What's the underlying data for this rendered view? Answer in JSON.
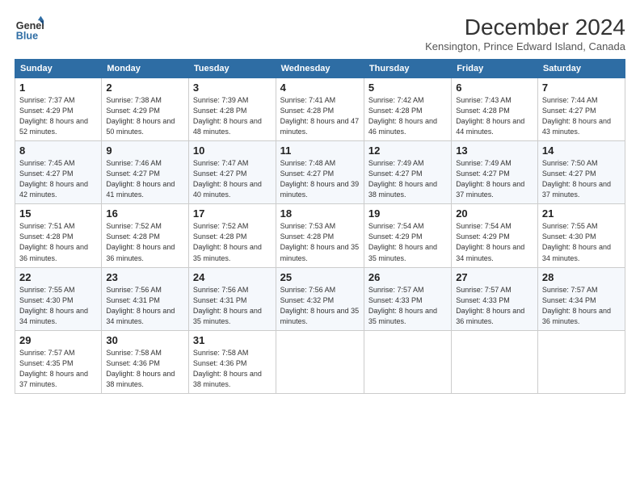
{
  "logo": {
    "line1": "General",
    "line2": "Blue"
  },
  "title": "December 2024",
  "subtitle": "Kensington, Prince Edward Island, Canada",
  "weekdays": [
    "Sunday",
    "Monday",
    "Tuesday",
    "Wednesday",
    "Thursday",
    "Friday",
    "Saturday"
  ],
  "weeks": [
    [
      {
        "day": "1",
        "sunrise": "7:37 AM",
        "sunset": "4:29 PM",
        "daylight": "8 hours and 52 minutes."
      },
      {
        "day": "2",
        "sunrise": "7:38 AM",
        "sunset": "4:29 PM",
        "daylight": "8 hours and 50 minutes."
      },
      {
        "day": "3",
        "sunrise": "7:39 AM",
        "sunset": "4:28 PM",
        "daylight": "8 hours and 48 minutes."
      },
      {
        "day": "4",
        "sunrise": "7:41 AM",
        "sunset": "4:28 PM",
        "daylight": "8 hours and 47 minutes."
      },
      {
        "day": "5",
        "sunrise": "7:42 AM",
        "sunset": "4:28 PM",
        "daylight": "8 hours and 46 minutes."
      },
      {
        "day": "6",
        "sunrise": "7:43 AM",
        "sunset": "4:28 PM",
        "daylight": "8 hours and 44 minutes."
      },
      {
        "day": "7",
        "sunrise": "7:44 AM",
        "sunset": "4:27 PM",
        "daylight": "8 hours and 43 minutes."
      }
    ],
    [
      {
        "day": "8",
        "sunrise": "7:45 AM",
        "sunset": "4:27 PM",
        "daylight": "8 hours and 42 minutes."
      },
      {
        "day": "9",
        "sunrise": "7:46 AM",
        "sunset": "4:27 PM",
        "daylight": "8 hours and 41 minutes."
      },
      {
        "day": "10",
        "sunrise": "7:47 AM",
        "sunset": "4:27 PM",
        "daylight": "8 hours and 40 minutes."
      },
      {
        "day": "11",
        "sunrise": "7:48 AM",
        "sunset": "4:27 PM",
        "daylight": "8 hours and 39 minutes."
      },
      {
        "day": "12",
        "sunrise": "7:49 AM",
        "sunset": "4:27 PM",
        "daylight": "8 hours and 38 minutes."
      },
      {
        "day": "13",
        "sunrise": "7:49 AM",
        "sunset": "4:27 PM",
        "daylight": "8 hours and 37 minutes."
      },
      {
        "day": "14",
        "sunrise": "7:50 AM",
        "sunset": "4:27 PM",
        "daylight": "8 hours and 37 minutes."
      }
    ],
    [
      {
        "day": "15",
        "sunrise": "7:51 AM",
        "sunset": "4:28 PM",
        "daylight": "8 hours and 36 minutes."
      },
      {
        "day": "16",
        "sunrise": "7:52 AM",
        "sunset": "4:28 PM",
        "daylight": "8 hours and 36 minutes."
      },
      {
        "day": "17",
        "sunrise": "7:52 AM",
        "sunset": "4:28 PM",
        "daylight": "8 hours and 35 minutes."
      },
      {
        "day": "18",
        "sunrise": "7:53 AM",
        "sunset": "4:28 PM",
        "daylight": "8 hours and 35 minutes."
      },
      {
        "day": "19",
        "sunrise": "7:54 AM",
        "sunset": "4:29 PM",
        "daylight": "8 hours and 35 minutes."
      },
      {
        "day": "20",
        "sunrise": "7:54 AM",
        "sunset": "4:29 PM",
        "daylight": "8 hours and 34 minutes."
      },
      {
        "day": "21",
        "sunrise": "7:55 AM",
        "sunset": "4:30 PM",
        "daylight": "8 hours and 34 minutes."
      }
    ],
    [
      {
        "day": "22",
        "sunrise": "7:55 AM",
        "sunset": "4:30 PM",
        "daylight": "8 hours and 34 minutes."
      },
      {
        "day": "23",
        "sunrise": "7:56 AM",
        "sunset": "4:31 PM",
        "daylight": "8 hours and 34 minutes."
      },
      {
        "day": "24",
        "sunrise": "7:56 AM",
        "sunset": "4:31 PM",
        "daylight": "8 hours and 35 minutes."
      },
      {
        "day": "25",
        "sunrise": "7:56 AM",
        "sunset": "4:32 PM",
        "daylight": "8 hours and 35 minutes."
      },
      {
        "day": "26",
        "sunrise": "7:57 AM",
        "sunset": "4:33 PM",
        "daylight": "8 hours and 35 minutes."
      },
      {
        "day": "27",
        "sunrise": "7:57 AM",
        "sunset": "4:33 PM",
        "daylight": "8 hours and 36 minutes."
      },
      {
        "day": "28",
        "sunrise": "7:57 AM",
        "sunset": "4:34 PM",
        "daylight": "8 hours and 36 minutes."
      }
    ],
    [
      {
        "day": "29",
        "sunrise": "7:57 AM",
        "sunset": "4:35 PM",
        "daylight": "8 hours and 37 minutes."
      },
      {
        "day": "30",
        "sunrise": "7:58 AM",
        "sunset": "4:36 PM",
        "daylight": "8 hours and 38 minutes."
      },
      {
        "day": "31",
        "sunrise": "7:58 AM",
        "sunset": "4:36 PM",
        "daylight": "8 hours and 38 minutes."
      },
      null,
      null,
      null,
      null
    ]
  ]
}
